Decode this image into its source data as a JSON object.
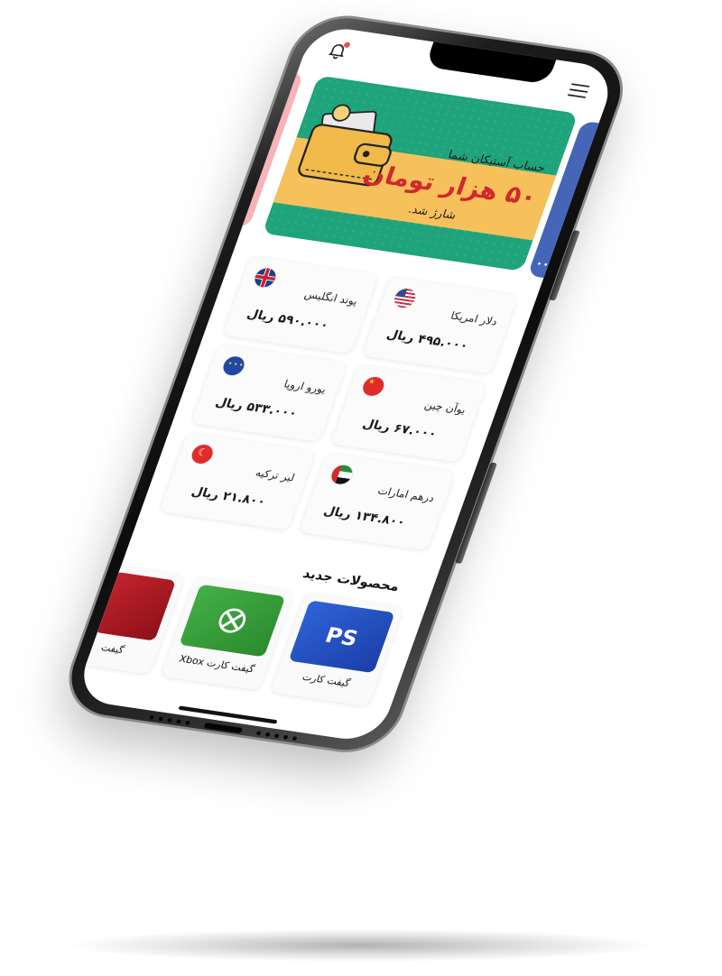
{
  "header": {
    "bell_icon": "bell-icon",
    "menu_icon": "hamburger-menu-icon",
    "notification_dot_color": "#ef4c4c"
  },
  "banner": {
    "line1": "حساب آستیکان شما",
    "line2": "۵۰ هزار تومان",
    "line3": "شارژ شد.",
    "bg_color": "#1fa37a",
    "stripe_color": "#f6c15a",
    "accent_color": "#d3262e"
  },
  "currencies": [
    {
      "name": "دلار امریکا",
      "price": "۴۹۵.۰۰۰  ریال",
      "flag": "us-flag-icon"
    },
    {
      "name": "پوند انگلیس",
      "price": "۵۹۰.۰۰۰  ریال",
      "flag": "uk-flag-icon"
    },
    {
      "name": "یوآن چین",
      "price": "۶۷.۰۰۰  ریال",
      "flag": "china-flag-icon"
    },
    {
      "name": "یورو اروپا",
      "price": "۵۳۳.۰۰۰  ریال",
      "flag": "eu-flag-icon"
    },
    {
      "name": "درهم امارات",
      "price": "۱۳۴.۸۰۰  ریال",
      "flag": "uae-flag-icon"
    },
    {
      "name": "لیر ترکیه",
      "price": "۲۱.۸۰۰  ریال",
      "flag": "turkey-flag-icon"
    }
  ],
  "new_products": {
    "title": "محصولات جدید",
    "items": [
      {
        "label": "گیفت کارت",
        "icon": "playstation-icon"
      },
      {
        "label": "گیفت کارت Xbox",
        "icon": "xbox-icon"
      },
      {
        "label": "گیفت",
        "icon": "gift-card-icon"
      }
    ]
  }
}
